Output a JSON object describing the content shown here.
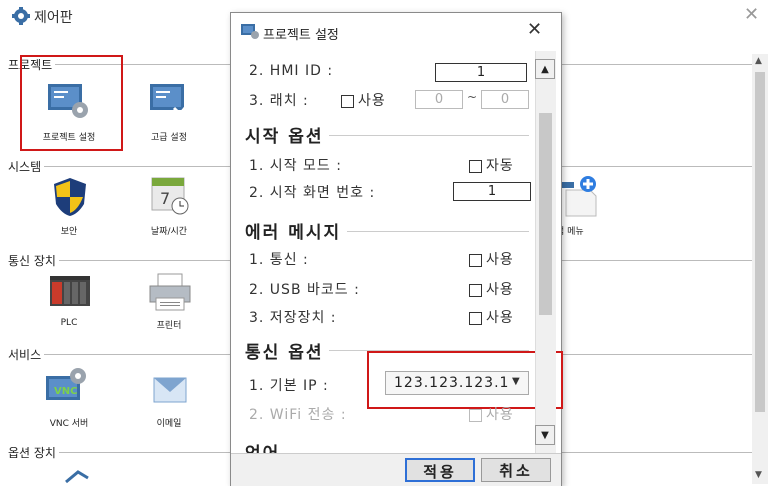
{
  "main_window": {
    "title": "제어판",
    "close_glyph": "✕",
    "sections": {
      "project": {
        "label": "프로젝트",
        "items": [
          {
            "label": "프로젝트 설정",
            "icon": "project-settings-icon"
          },
          {
            "label": "고급 설정",
            "icon": "advanced-settings-icon"
          }
        ]
      },
      "system": {
        "label": "시스템",
        "items": [
          {
            "label": "보안",
            "icon": "security-shield-icon"
          },
          {
            "label": "날짜/시간",
            "icon": "calendar-clock-icon"
          },
          {
            "label": "업 메뉴",
            "icon": "popup-menu-icon"
          }
        ]
      },
      "comm_device": {
        "label": "통신 장치",
        "items": [
          {
            "label": "PLC",
            "icon": "plc-icon"
          },
          {
            "label": "프린터",
            "icon": "printer-icon"
          }
        ]
      },
      "service": {
        "label": "서비스",
        "items": [
          {
            "label": "VNC 서버",
            "icon": "vnc-server-icon"
          },
          {
            "label": "이메일",
            "icon": "email-icon"
          }
        ]
      },
      "option_device": {
        "label": "옵션 장치"
      }
    }
  },
  "dialog": {
    "title": "프로젝트 설정",
    "close_glyph": "✕",
    "rows": {
      "hmi_id": {
        "label": "2. HMI ID :",
        "value": "1"
      },
      "latch": {
        "label": "3. 래치 :",
        "checkbox_label": "사용",
        "from": "0",
        "sep": "~",
        "to": "0"
      }
    },
    "groups": {
      "start_options": {
        "title": "시작 옵션",
        "start_mode": {
          "label": "1. 시작 모드 :",
          "checkbox_label": "자동"
        },
        "start_screen": {
          "label": "2. 시작 화면 번호 :",
          "value": "1"
        }
      },
      "error_messages": {
        "title": "에러 메시지",
        "comm": {
          "label": "1. 통신 :",
          "checkbox_label": "사용"
        },
        "usb": {
          "label": "2. USB 바코드 :",
          "checkbox_label": "사용"
        },
        "storage": {
          "label": "3. 저장장치 :",
          "checkbox_label": "사용"
        }
      },
      "comm_options": {
        "title": "통신 옵션",
        "base_ip": {
          "label": "1. 기본 IP :",
          "value": "123.123.123.1"
        },
        "wifi": {
          "label": "2. WiFi 전송 :",
          "checkbox_label": "사용"
        }
      },
      "language": {
        "title": "언어"
      }
    },
    "buttons": {
      "apply": "적용",
      "cancel": "취소"
    }
  },
  "colors": {
    "highlight": "#d01818",
    "primary_button_border": "#2e6fd6"
  }
}
